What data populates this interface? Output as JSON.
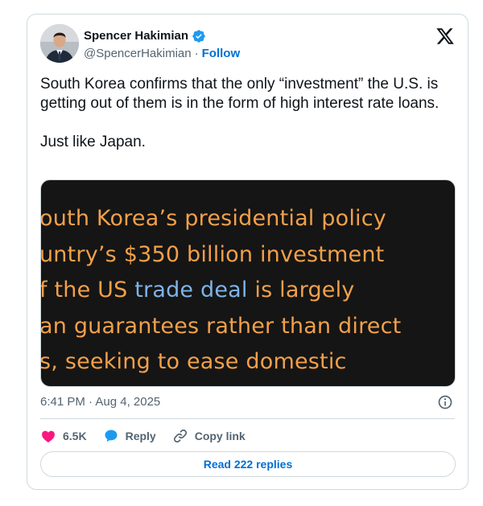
{
  "author": {
    "name": "Spencer Hakimian",
    "handle": "@SpencerHakimian",
    "separator": "·",
    "follow_label": "Follow"
  },
  "tweet": {
    "text_paragraph_1": "South Korea confirms that the only “investment” the U.S. is getting out of them is in the form of high interest rate loans.",
    "text_paragraph_2": "Just like Japan."
  },
  "media": {
    "line_1": "outh Korea’s presidential policy",
    "line_2": "untry’s $350 billion investment",
    "line_3_prefix": "f the US ",
    "line_3_link": "trade deal",
    "line_3_suffix": " is largely",
    "line_4": "an guarantees rather than direct",
    "line_5": "s, seeking to ease domestic"
  },
  "timestamp": "6:41 PM · Aug 4, 2025",
  "actions": {
    "like_count": "6.5K",
    "reply_label": "Reply",
    "copy_link_label": "Copy link"
  },
  "read_replies_label": "Read 222 replies",
  "colors": {
    "accent": "#006fd6",
    "verified": "#1d9bf0",
    "like": "#f91880",
    "media_text": "#f2a04a",
    "media_link": "#7fb3e8"
  }
}
